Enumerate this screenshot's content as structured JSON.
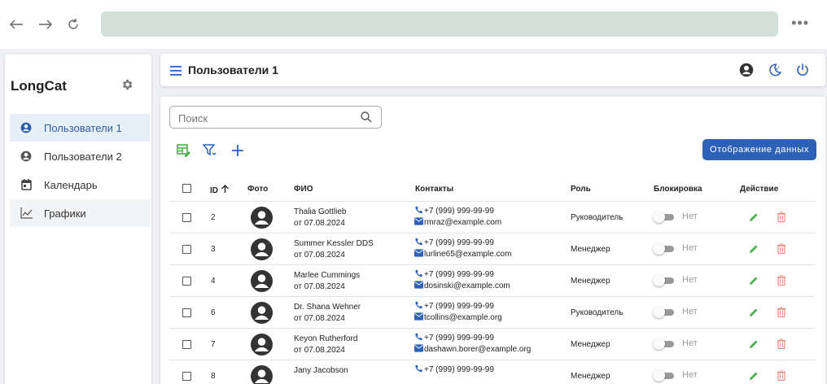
{
  "app": {
    "title": "LongCat"
  },
  "sidebar": {
    "items": [
      {
        "label": "Пользователи 1",
        "icon": "user-circle-icon"
      },
      {
        "label": "Пользователи 2",
        "icon": "user-circle-icon"
      },
      {
        "label": "Календарь",
        "icon": "calendar-icon"
      },
      {
        "label": "Графики",
        "icon": "chart-icon"
      }
    ]
  },
  "header": {
    "title": "Пользователи 1"
  },
  "search": {
    "placeholder": "Поиск"
  },
  "toolbar": {
    "display_button": "Отображение данных"
  },
  "table": {
    "headers": {
      "id": "ID",
      "photo": "Фото",
      "name": "ФИО",
      "contacts": "Контакты",
      "role": "Роль",
      "block": "Блокировка",
      "action": "Действие"
    },
    "rows": [
      {
        "id": "2",
        "name": "Thalia Gottlieb",
        "date": "от 07.08.2024",
        "phone": "+7 (999) 999-99-99",
        "email": "rmraz@example.com",
        "role": "Руководитель",
        "blocked": "Нет"
      },
      {
        "id": "3",
        "name": "Summer Kessler DDS",
        "date": "от 07.08.2024",
        "phone": "+7 (999) 999-99-99",
        "email": "lurline65@example.com",
        "role": "Менеджер",
        "blocked": "Нет"
      },
      {
        "id": "4",
        "name": "Marlee Cummings",
        "date": "от 07.08.2024",
        "phone": "+7 (999) 999-99-99",
        "email": "dosinski@example.com",
        "role": "Менеджер",
        "blocked": "Нет"
      },
      {
        "id": "6",
        "name": "Dr. Shana Wehner",
        "date": "от 07.08.2024",
        "phone": "+7 (999) 999-99-99",
        "email": "tcollins@example.org",
        "role": "Руководитель",
        "blocked": "Нет"
      },
      {
        "id": "7",
        "name": "Keyon Rutherford",
        "date": "от 07.08.2024",
        "phone": "+7 (999) 999-99-99",
        "email": "dashawn.borer@example.org",
        "role": "Менеджер",
        "blocked": "Нет"
      },
      {
        "id": "8",
        "name": "Jany Jacobson",
        "date": "",
        "phone": "+7 (999) 999-99-99",
        "email": "",
        "role": "Менеджер",
        "blocked": "Нет"
      }
    ]
  },
  "colors": {
    "accent": "#2d62b8",
    "edit": "#4caf50",
    "delete": "#ef8a80",
    "active_bg": "#e6eef8"
  }
}
